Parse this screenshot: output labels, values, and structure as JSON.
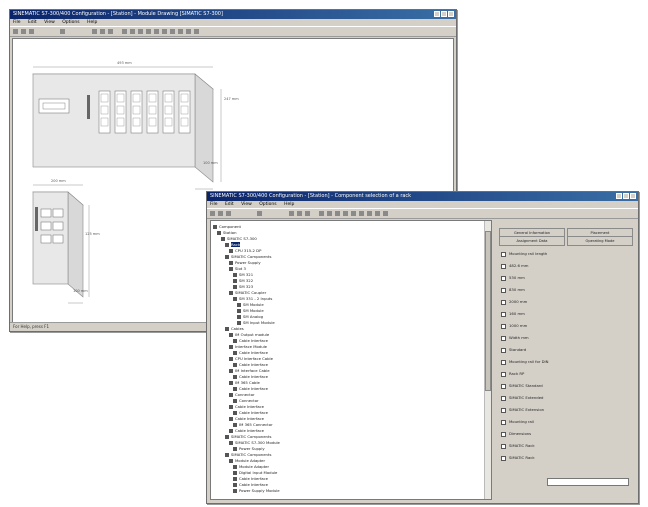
{
  "back_window": {
    "title": "SINEMATIC S7-300/400 Configuration - [Station] - Module Drawing [SIMATIC S7-300]",
    "menu": [
      "File",
      "Edit",
      "View",
      "Options",
      "Help"
    ],
    "status": "For Help, press F1",
    "dims": {
      "top_width": "493 mm",
      "right_height": "247 mm",
      "right_depth": "100 mm",
      "small_width": "200 mm",
      "small_height": "125 mm",
      "small_depth": "100 mm"
    }
  },
  "front_window": {
    "title": "SINEMATIC S7-300/400 Configuration - [Station] - Component selection of a rack",
    "menu": [
      "File",
      "Edit",
      "View",
      "Options",
      "Help"
    ],
    "tree_items": [
      "Component",
      "Station",
      "SIMATIC S7-300",
      "Rack",
      "CPU 315-2 DP",
      "SIMATIC Components",
      "Power Supply",
      "Slot 3",
      "SM 321",
      "SM 322",
      "SM 323",
      "SIMATIC Coupler",
      "SM 331 - 2 Inputs",
      "SM Module",
      "SM Module",
      "SM Analog",
      "SM Input Module",
      "Cables",
      "IM Output module",
      "Cable Interface",
      "Interface Module",
      "Cable Interface",
      "CPU Interface Cable",
      "Cable Interface",
      "IM Interface Cable",
      "Cable Interface",
      "IM 365 Cable",
      "Cable Interface",
      "Connector",
      "Connector",
      "Cable Interface",
      "Cable Interface",
      "Cable Interface",
      "IM 365 Connector",
      "Cable Interface",
      "SIMATIC Components",
      "SIMATIC S7-300 Module",
      "Power Supply",
      "SIMATIC Components",
      "Module Adapter",
      "Module Adapter",
      "Digital Input Module",
      "Cable Interface",
      "Cable Interface",
      "Power Supply Module"
    ],
    "tabs": [
      "General Information",
      "Placement",
      "Assignment Data",
      "Operating Mode"
    ],
    "properties": [
      "Mounting rail length",
      "482.6 mm",
      "530 mm",
      "830 mm",
      "2000 mm",
      "160 mm",
      "1000 mm",
      "Width mm",
      "Standard",
      "Mounting rail for DIN",
      "Rack RP",
      "SIMATIC Standard",
      "SIMATIC Extended",
      "SIMATIC Extension",
      "Mounting rail",
      "Dimensions",
      "SIMATIC Rack",
      "SIMATIC Rack"
    ]
  }
}
